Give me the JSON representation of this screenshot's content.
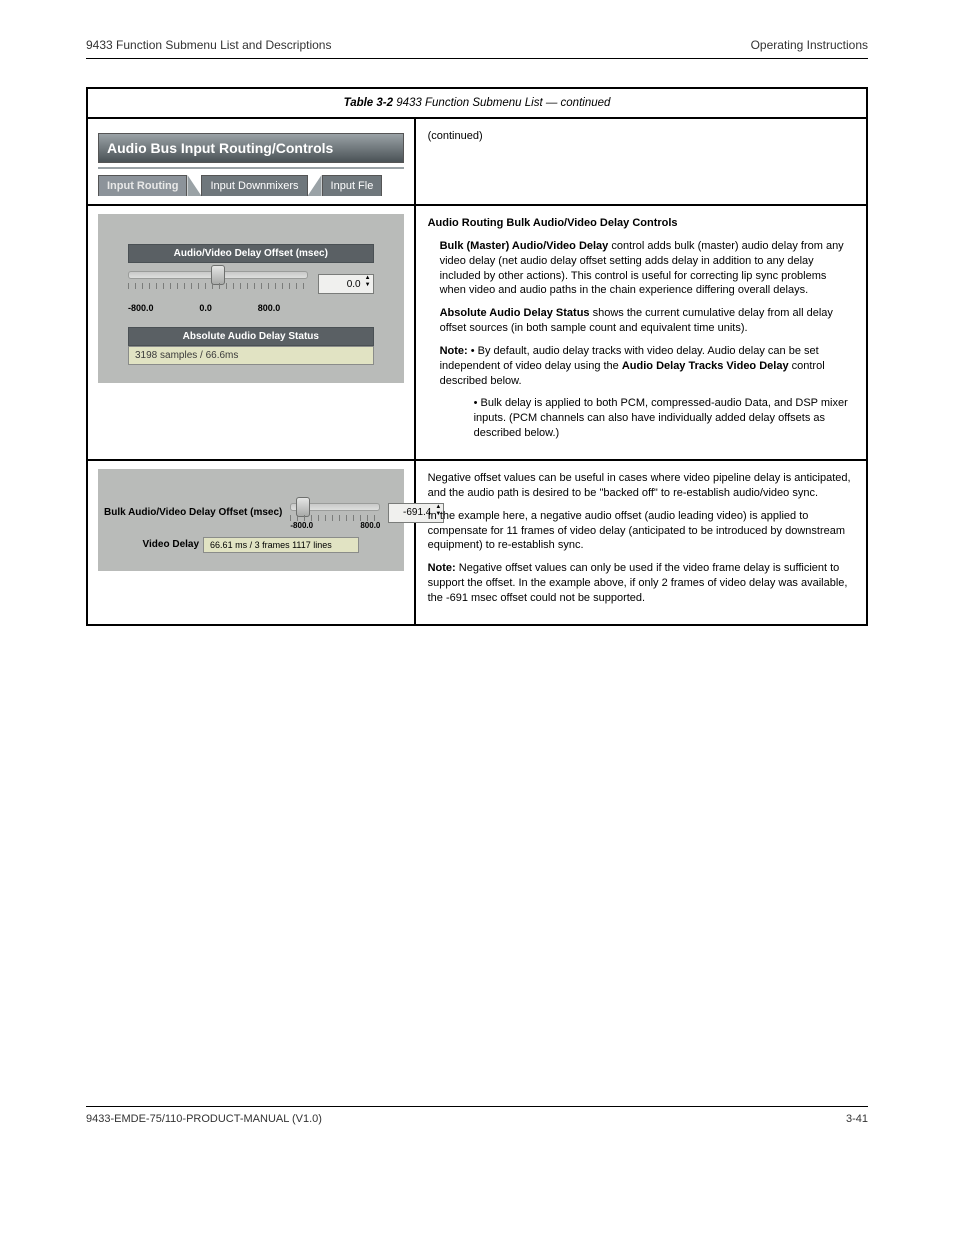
{
  "header": {
    "left": "9433 Function Submenu List and Descriptions",
    "right": "Operating Instructions"
  },
  "tableTitleLeft": "Table 3-2",
  "tableTitleRight": "9433 Function Submenu List — continued",
  "panelHeader": "Audio Bus Input Routing/Controls",
  "tabs": {
    "inputRouting": "Input Routing",
    "inputDownmixers": "Input Downmixers",
    "inputFle": "Input Fle"
  },
  "row1": {
    "sectionTitle": "Audio/Video Delay Offset (msec)",
    "tickLabels": {
      "min": "-800.0",
      "mid": "0.0",
      "max": "800.0"
    },
    "spinValue": "0.0",
    "statusTitle": "Absolute Audio Delay Status",
    "statusValue": "3198 samples / 66.6ms",
    "continuedTag": "(continued)",
    "rtTitle": "Audio Routing Bulk Audio/Video Delay Controls",
    "rtP1a": "Bulk (Master) Audio/Video Delay",
    "rtP1b": " control adds bulk (master) audio delay from any video delay (net audio delay offset setting adds delay in addition to any delay included by other actions). This control is useful for correcting lip sync problems when video and audio paths in the chain experience differing overall delays.",
    "rtP2a": "Absolute Audio Delay Status",
    "rtP2b": " shows the current cumulative delay from all delay offset sources (in both sample count and equivalent time units).",
    "rtNotePrefix": "Note:",
    "rtNote1": " • By default, audio delay tracks with video delay. Audio delay can be set independent of video delay using the ",
    "rtNote1b": "Audio Delay Tracks Video Delay",
    "rtNote1c": " control described below.",
    "rtNote2": "• Bulk delay is applied to both PCM, compressed-audio Data, and DSP mixer inputs. (PCM channels can also have individually added delay offsets as described below.)"
  },
  "row2": {
    "leftLabel": "Bulk Audio/Video Delay Offset (msec)",
    "tickLabels": {
      "min": "-800.0",
      "max": "800.0"
    },
    "spinValue": "-691.4",
    "videoDelayLabel": "Video Delay",
    "videoDelayValue": "66.61 ms / 3 frames 1117 lines",
    "rt1a": "Negative offset values can be useful in cases where video pipeline delay is anticipated, and the audio path is desired to be \"backed off\" to re-establish audio/video sync.",
    "rt1b": "In the example here, a negative audio offset (audio leading video) is applied to compensate for 11 frames of video delay (anticipated to be introduced by downstream equipment) to re-establish sync.",
    "rtNotePrefix": "Note:",
    "rtNote": " Negative offset values can only be used if the video frame delay is sufficient to support the offset. In the example above, if only 2 frames of video delay was available, the -691 msec offset could not be supported."
  },
  "footer": {
    "left": "9433-EMDE-75/110-PRODUCT-MANUAL (V1.0)",
    "right": "3-41"
  }
}
